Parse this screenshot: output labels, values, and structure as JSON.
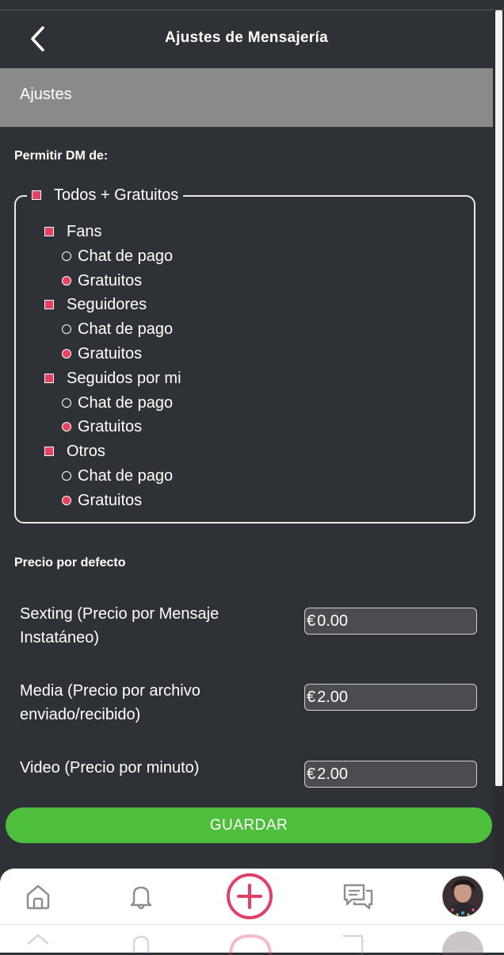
{
  "header": {
    "title": "Ajustes de Mensajería"
  },
  "section": {
    "title": "Ajustes"
  },
  "dm": {
    "label": "Permitir DM de:",
    "legend": "Todos + Gratuitos",
    "groups": [
      {
        "label": "Fans",
        "options": [
          "Chat de pago",
          "Gratuitos"
        ],
        "selected": "Gratuitos"
      },
      {
        "label": "Seguidores",
        "options": [
          "Chat de pago",
          "Gratuitos"
        ],
        "selected": "Gratuitos"
      },
      {
        "label": "Seguidos por mi",
        "options": [
          "Chat de pago",
          "Gratuitos"
        ],
        "selected": "Gratuitos"
      },
      {
        "label": "Otros",
        "options": [
          "Chat de pago",
          "Gratuitos"
        ],
        "selected": "Gratuitos"
      }
    ]
  },
  "pricing": {
    "label": "Precio por defecto",
    "currency": "€",
    "items": [
      {
        "label": "Sexting (Precio por Mensaje Instatáneo)",
        "value": "0.00"
      },
      {
        "label": "Media (Precio por archivo enviado/recibido)",
        "value": "2.00"
      },
      {
        "label": "Video (Precio por minuto)",
        "value": "2.00"
      }
    ]
  },
  "save_label": "GUARDAR",
  "nav": {
    "items": [
      "home-icon",
      "bell-icon",
      "add-post-icon",
      "chat-icon",
      "avatar"
    ]
  },
  "colors": {
    "background": "#2e3135",
    "accent": "#e8405f",
    "save": "#4dbf3a",
    "section_bar": "#8a8a8a"
  }
}
